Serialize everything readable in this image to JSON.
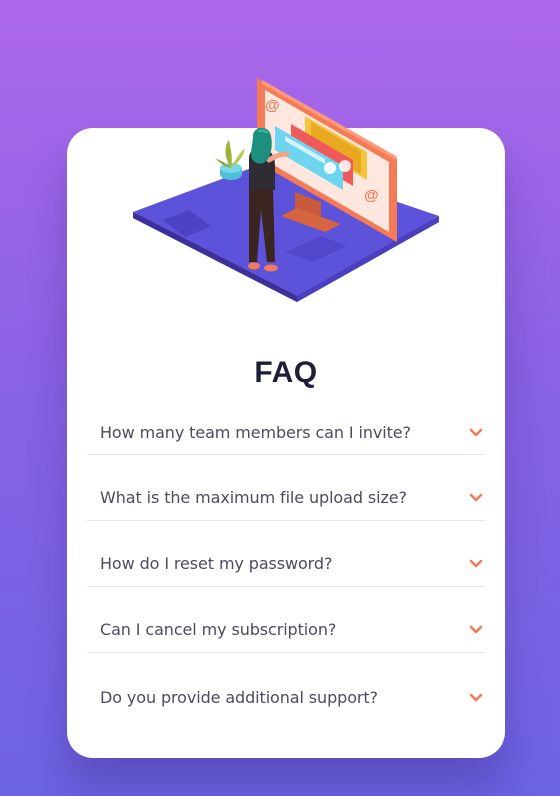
{
  "colors": {
    "background_top": "#ad68ea",
    "background_bottom": "#6c63e3",
    "card": "#ffffff",
    "title": "#1e1f36",
    "question_text": "#4b4c5f",
    "accent": "#f47b56",
    "divider": "#e3e3eb"
  },
  "illustration": {
    "icon": "woman-online-desk-illustration"
  },
  "faq": {
    "title": "FAQ",
    "items": [
      {
        "question": "How many team members can I invite?",
        "icon": "chevron-down-icon"
      },
      {
        "question": "What is the maximum file upload size?",
        "icon": "chevron-down-icon"
      },
      {
        "question": "How do I reset my password?",
        "icon": "chevron-down-icon"
      },
      {
        "question": "Can I cancel my subscription?",
        "icon": "chevron-down-icon"
      },
      {
        "question": "Do you provide additional support?",
        "icon": "chevron-down-icon"
      }
    ]
  }
}
